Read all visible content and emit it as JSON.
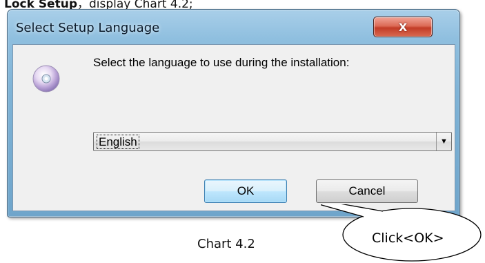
{
  "caption_top": {
    "bold": "Lock Setup",
    "rest": "，display Chart 4.2;"
  },
  "window": {
    "title": "Select Setup Language",
    "close_glyph": "X"
  },
  "dialog": {
    "icon": "cd-disc-icon",
    "prompt": "Select the language to use during the installation:",
    "language_select": {
      "value": "English"
    },
    "ok_label": "OK",
    "cancel_label": "Cancel"
  },
  "annotation": {
    "callout_text": "Click<OK>"
  },
  "caption_bottom": "Chart 4.2",
  "colors": {
    "ok_border": "#3c7fb1",
    "close_red": "#c23b26",
    "frame_blue": "#7fb3d6"
  }
}
